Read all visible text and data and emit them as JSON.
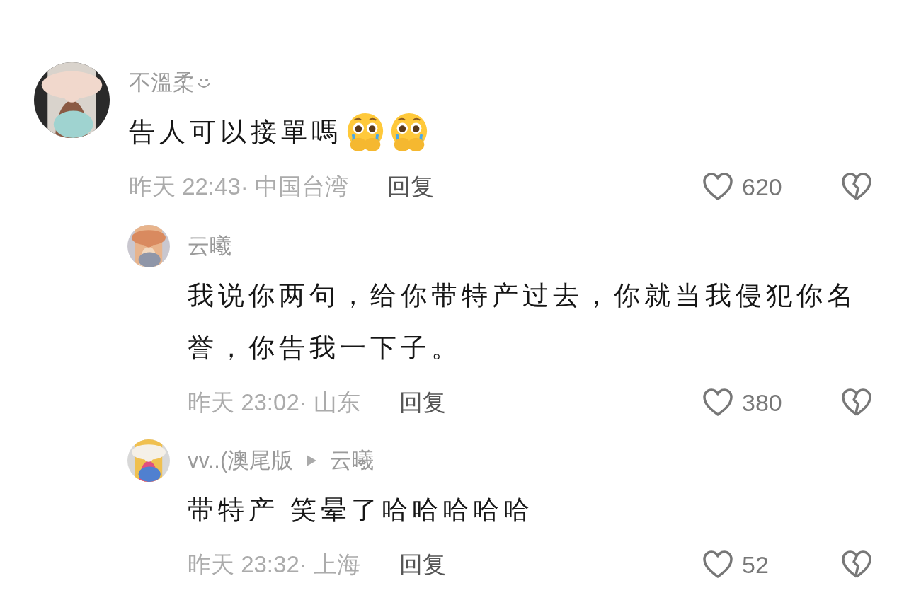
{
  "comments": [
    {
      "kind": "top",
      "user": "不溫柔",
      "user_smile": true,
      "text": "告人可以接單嗎",
      "emojis": [
        {
          "kind": "pleading-face"
        },
        {
          "kind": "pleading-face"
        }
      ],
      "time": "昨天 22:43·",
      "location": "中国台湾",
      "reply": "回复",
      "likes": "620"
    },
    {
      "kind": "reply",
      "user": "云曦",
      "text": "我说你两句，给你带特产过去，你就当我侵犯你名誉，你告我一下子。",
      "time": "昨天 23:02·",
      "location": "山东",
      "reply": "回复",
      "likes": "380"
    },
    {
      "kind": "reply",
      "user": "vv..(澳尾版",
      "reply_to": "云曦",
      "text": "带特产 笑晕了哈哈哈哈哈",
      "time": "昨天 23:32·",
      "location": "上海",
      "reply": "回复",
      "likes": "52"
    }
  ]
}
